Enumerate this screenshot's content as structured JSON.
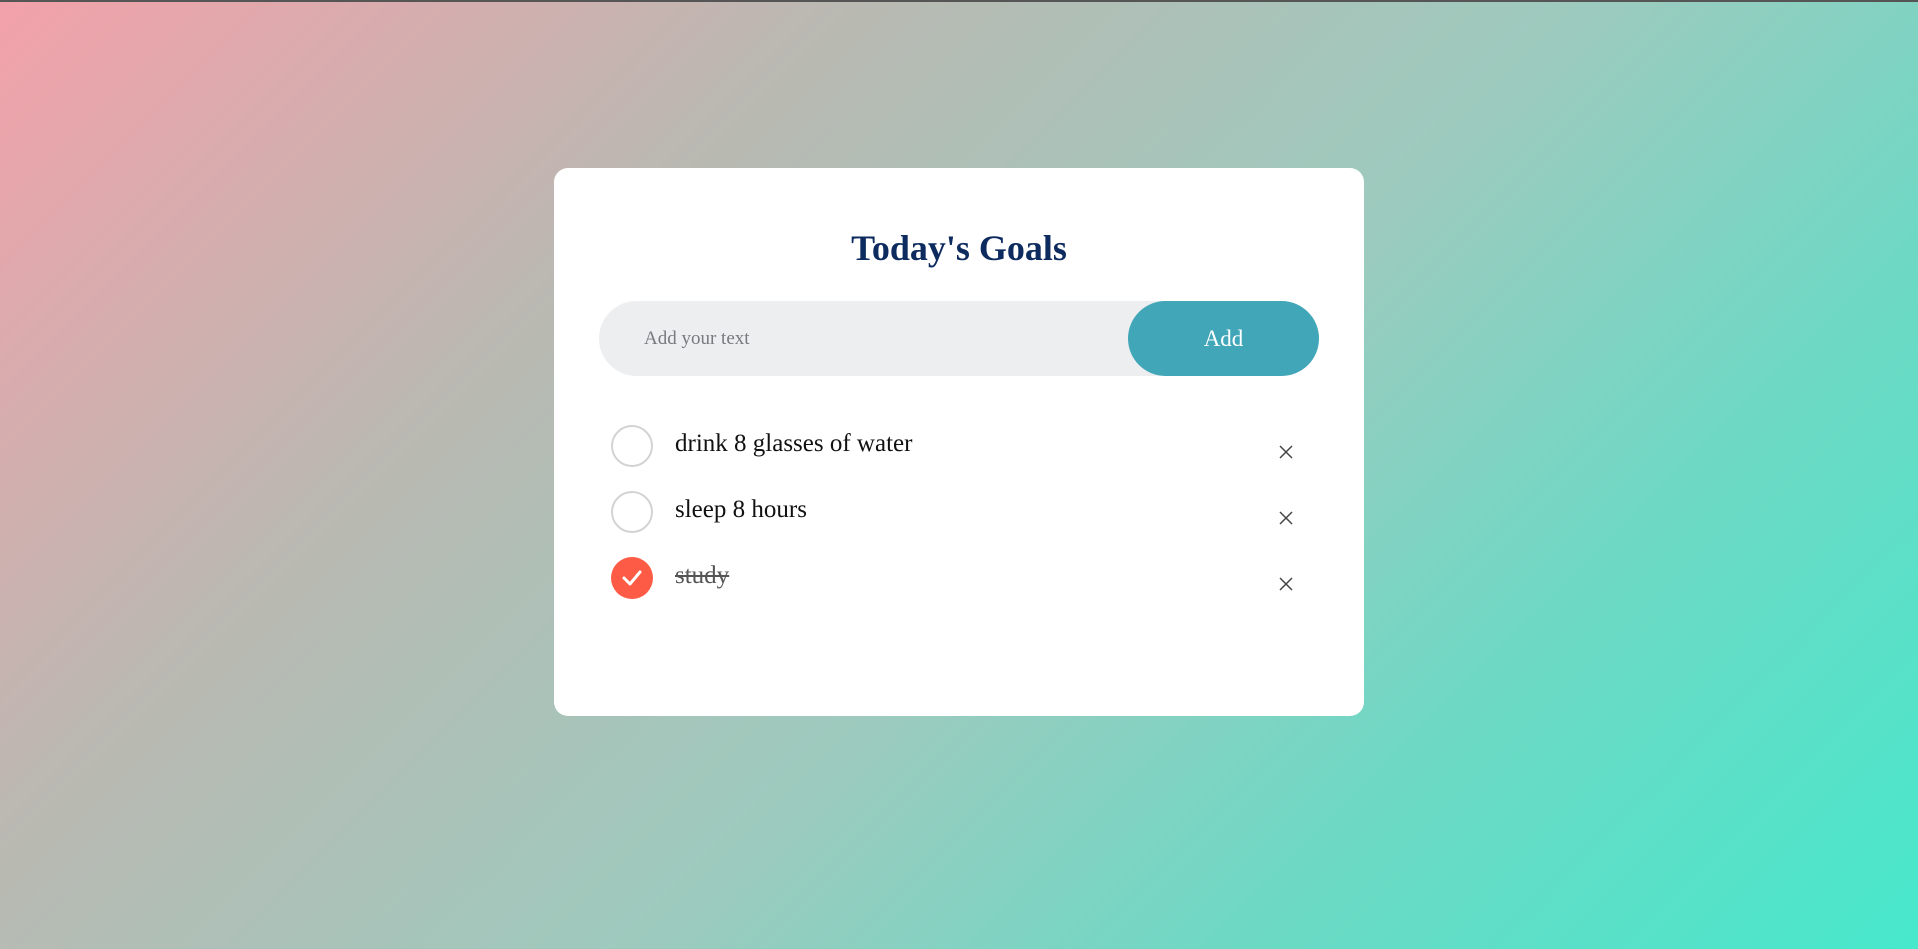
{
  "card": {
    "title": "Today's Goals"
  },
  "input": {
    "placeholder": "Add your text",
    "value": "",
    "add_label": "Add"
  },
  "tasks": [
    {
      "label": "drink 8 glasses of water",
      "checked": false
    },
    {
      "label": "sleep 8 hours",
      "checked": false
    },
    {
      "label": "study",
      "checked": true
    }
  ],
  "icons": {
    "check": "check-icon",
    "delete": "close-icon"
  },
  "colors": {
    "title": "#0d2b5e",
    "add_button": "#40a6b8",
    "checked": "#fd5b45",
    "input_bg": "#edeef0"
  }
}
